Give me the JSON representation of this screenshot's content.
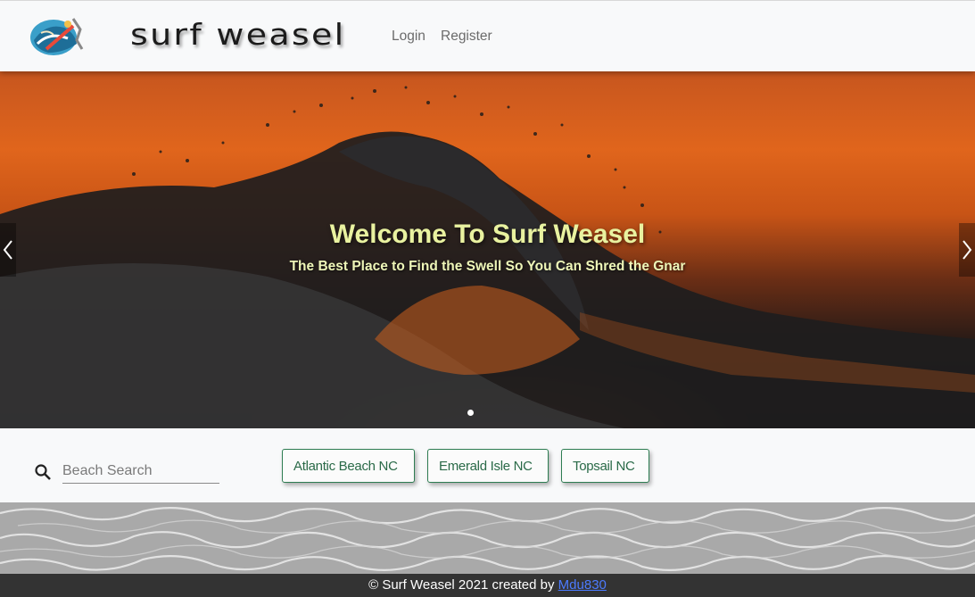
{
  "header": {
    "logo_icon": "surfer-logo-icon",
    "brand": "surf weasel",
    "nav": {
      "login": "Login",
      "register": "Register"
    }
  },
  "hero": {
    "title": "Welcome To Surf Weasel",
    "subtitle": "The Best Place to Find the Swell So You Can Shred the Gnar",
    "prev_icon": "chevron-left-icon",
    "next_icon": "chevron-right-icon",
    "slide_count": 1,
    "active_slide": 1
  },
  "search": {
    "placeholder": "Beach Search",
    "value": "",
    "icon": "search-icon"
  },
  "beaches": [
    {
      "label": "Atlantic Beach NC"
    },
    {
      "label": "Emerald Isle NC"
    },
    {
      "label": "Topsail NC"
    }
  ],
  "footer": {
    "text": "© Surf Weasel 2021 created by ",
    "link": "Mdu830"
  },
  "colors": {
    "header_bg": "#f8f9fa",
    "hero_title": "#e9f2a0",
    "button_border": "#2e7d52",
    "footer_bg": "#333333",
    "footer_link": "#4c7bff"
  }
}
